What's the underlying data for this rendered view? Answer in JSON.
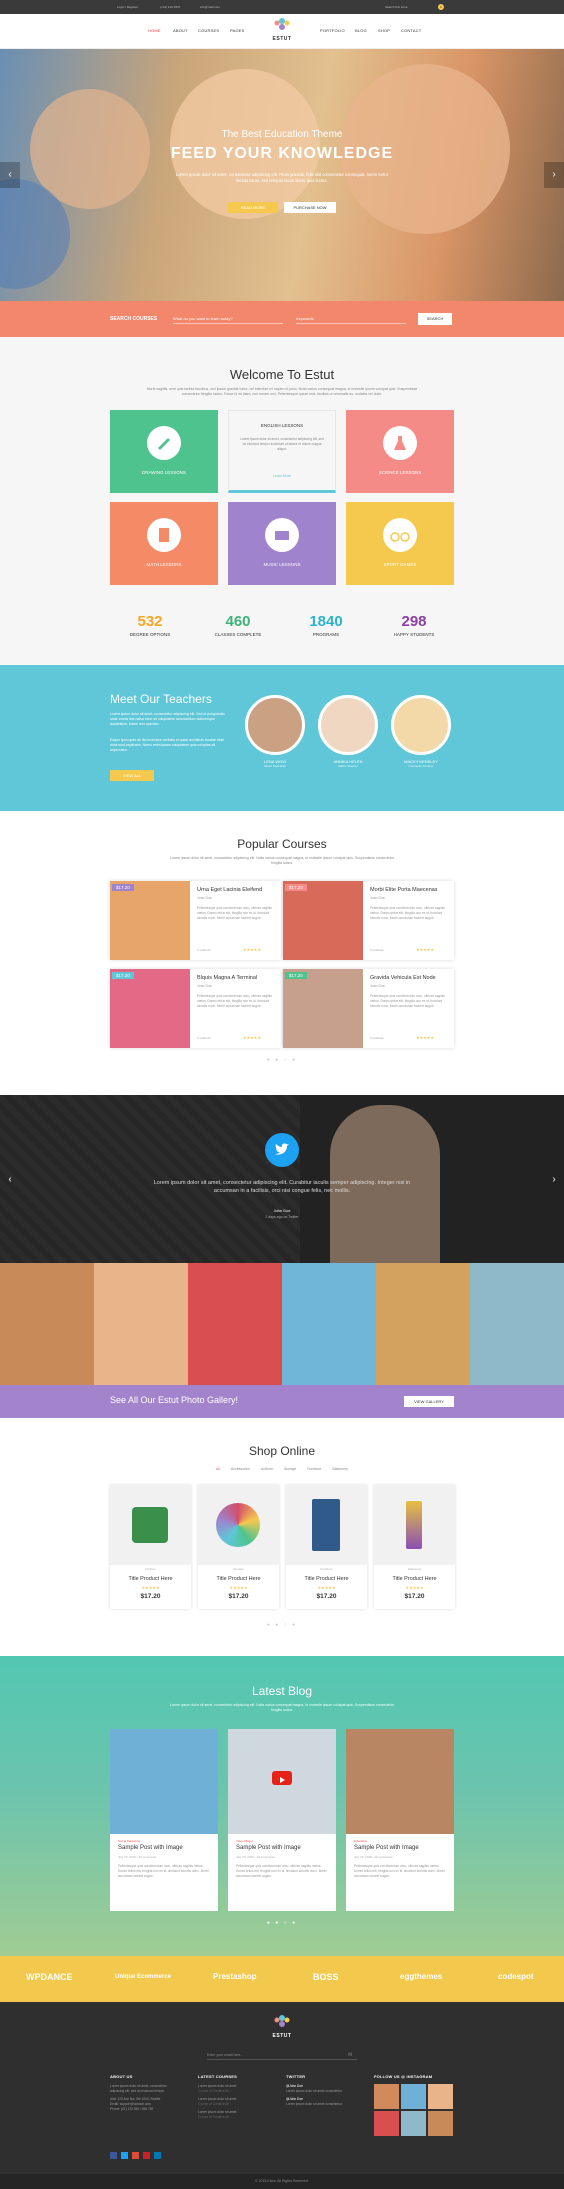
{
  "topbar": {
    "login": "Login / Register",
    "phone": "(+01) 123 4567",
    "email": "info@mail.com",
    "search_placeholder": "Search this store",
    "cart_count": "0"
  },
  "header": {
    "logo_text": "ESTUT",
    "nav_left": [
      "HOME",
      "ABOUT",
      "COURSES",
      "PAGES"
    ],
    "nav_right": [
      "PORTFOLIO",
      "BLOG",
      "SHOP",
      "CONTACT"
    ]
  },
  "hero": {
    "subtitle": "The Best Education Theme",
    "title": "FEED YOUR KNOWLEDGE",
    "text": "Lorem Ipsum dolor sit amet, consectetur adipiscing elit. Proin gravida, felis nisl consectetur consequat, lorem tortor lacinia lacus, sed tempus lacus libero quis lectus.",
    "btn_primary": "READ MORE",
    "btn_secondary": "PURCHASE NOW"
  },
  "search": {
    "label": "SEARCH COURSES",
    "placeholder": "What do you want to learn today?",
    "keyword_placeholder": "Keywords",
    "button": "SEARCH"
  },
  "welcome": {
    "title": "Welcome To Estut",
    "intro": "Morbi sagittis, sem quis lacinia faucibus, orci ipsum gravida tortor, vel interdum mi sapien ut justo. Nulla varius consequat magna, id molestie ipsum volutpat quis. Suspendisse consectetur fringilla luctus. Fusce id mi diam, non ornare orci. Pellentesque ipsum erat, facilisis ut venenatis eu, sodales vel dolor.",
    "cards": [
      {
        "label": "DRAWING LESSONS",
        "color": "#4fc38e",
        "icon": "pencil-icon"
      },
      {
        "label": "ENGLISH LESSONS",
        "color": "#ffffff",
        "icon": "book-icon",
        "text": "Lorem ipsum dolor sit amet, consectetur adipiscing elit, sed do eiusmod tempor incididunt ut labore et dolore magna aliqua.",
        "link": "Learn More"
      },
      {
        "label": "SCIENCE LESSONS",
        "color": "#f58b87",
        "icon": "flask-icon"
      },
      {
        "label": "MATH LESSONS",
        "color": "#f58a67",
        "icon": "calculator-icon"
      },
      {
        "label": "MUSIC LESSONS",
        "color": "#9f83cc",
        "icon": "piano-icon"
      },
      {
        "label": "SPORT GAMES",
        "color": "#f5c94e",
        "icon": "bicycle-icon"
      }
    ],
    "stats": [
      {
        "num": "532",
        "label": "DEGREE OPTIONS",
        "color": "#f5a623"
      },
      {
        "num": "460",
        "label": "CLASSES COMPLETE",
        "color": "#3db37a"
      },
      {
        "num": "1840",
        "label": "PROGRAMS",
        "color": "#2db3c9"
      },
      {
        "num": "298",
        "label": "HAPPY STUDENTS",
        "color": "#8e3fa6"
      }
    ]
  },
  "teachers": {
    "title": "Meet Our Teachers",
    "text1": "Lorem ipsum dolor sit amet, consectetur adipiscing elit. Sed ut perspiciatis unde omnis iste natus error sit voluptatem accusantium doloremque laudantium, totam rem aperiam.",
    "text2": "Eaque ipsa quae ab illo inventore veritatis et quasi architecto beatae vitae dicta sunt explicabo. Nemo enim ipsam voluptatem quia voluptas sit aspernatur.",
    "button": "VIEW ALL",
    "list": [
      {
        "name": "LENA WOW",
        "role": "Music Specialist"
      },
      {
        "name": "ANNIKA HELEN",
        "role": "Maths Teacher"
      },
      {
        "name": "MACEY KENSLEY",
        "role": "Counselor Teacher"
      }
    ]
  },
  "popular": {
    "title": "Popular Courses",
    "intro": "Lorem ipsum dolor sit amet, consectetur adipiscing elit. Nulla varius consequat magna, id molestie ipsum volutpat quis. Suspendisse consectetur fringilla luctus.",
    "courses": [
      {
        "price": "$17.20",
        "price_color": "#9f83cc",
        "title": "Urna Eget Lacinia Eleifend",
        "author": "John Doe",
        "text": "Pellentesque quis condimentum arcu, ultrices sagittis metus. Donec tellus elit, fringilla non ex id, tincidunt lobortis nunc. Morbi accumsan laoreet augue.",
        "students": "5 students",
        "img": "#e8a56a"
      },
      {
        "price": "$17.20",
        "price_color": "#f58b87",
        "title": "Morbi Elite Porta Maecenas",
        "author": "John Doe",
        "text": "Pellentesque quis condimentum arcu, ultrices sagittis metus. Donec tellus elit, fringilla non ex id, tincidunt lobortis nunc. Morbi accumsan laoreet augue.",
        "students": "5 students",
        "img": "#d86a5a"
      },
      {
        "price": "$17.20",
        "price_color": "#5fc7d8",
        "title": "Blquis Magna A Terminal",
        "author": "John Doe",
        "text": "Pellentesque quis condimentum arcu, ultrices sagittis metus. Donec tellus elit, fringilla non ex id, tincidunt lobortis nunc. Morbi accumsan laoreet augue.",
        "students": "5 students",
        "img": "#e26a86"
      },
      {
        "price": "$17.20",
        "price_color": "#4fc38e",
        "title": "Gravida Vehicula Est Node",
        "author": "John Doe",
        "text": "Pellentesque quis condimentum arcu, ultrices sagittis metus. Donec tellus elit, fringilla non ex id, tincidunt lobortis nunc. Morbi accumsan laoreet augue.",
        "students": "5 students",
        "img": "#c6a08c"
      }
    ],
    "rating": "★★★★★"
  },
  "testimonial": {
    "text": "Lorem ipsum dolor sit amet, consectetur adipiscing elit. Curabitur iaculis semper adipiscing. Integer nisi in accumsan in a facilisis, orci nisi congue felis, nec mollis.",
    "author": "John Doe",
    "meta": "2 days ago on Twitter"
  },
  "gallery": {
    "text": "See All Our Estut Photo Gallery!",
    "button": "VIEW GALLERY",
    "tiles": [
      "#c98a5a",
      "#e9b48a",
      "#d94f4f",
      "#6fb6d9",
      "#d2a25e",
      "#8fb9c9"
    ]
  },
  "shop": {
    "title": "Shop Online",
    "filters": [
      "All",
      "Accessories",
      "Uniform",
      "Storage",
      "Furniture",
      "Stationery"
    ],
    "products": [
      {
        "cat": "Uniform",
        "title": "Title Product Here",
        "price": "$17.20",
        "color": "#3a8f4a"
      },
      {
        "cat": "Storage",
        "title": "Title Product Here",
        "price": "$17.20",
        "color": "#d44d6a"
      },
      {
        "cat": "Furniture",
        "title": "Title Product Here",
        "price": "$17.20",
        "color": "#2f5a8a"
      },
      {
        "cat": "Stationery",
        "title": "Title Product Here",
        "price": "$17.20",
        "color": "#e6c040"
      }
    ],
    "rating": "★★★★★"
  },
  "blog": {
    "title": "Latest Blog",
    "intro": "Lorem ipsum dolor sit amet, consectetur adipiscing elit. Nulla varius consequat magna, id molestie ipsum volutpat quis. Suspendisse consectetur fringilla luctus.",
    "posts": [
      {
        "cat": "Social Marketing",
        "title": "Sample Post with Image",
        "meta": "July 15, 2015  •  10 comments",
        "text": "Pellentesque quis condimentum arcu, ultrices sagittis metus. Donec tellus elit, fringilla non ex id, tincidunt lobortis nunc. Morbi accumsan laoreet augue.",
        "img": "#6fb0d6"
      },
      {
        "cat": "Video Player",
        "title": "Sample Post with Image",
        "meta": "July 15, 2015  •  10 comments",
        "text": "Pellentesque quis condimentum arcu, ultrices sagittis metus. Donec tellus elit, fringilla non ex id, tincidunt lobortis nunc. Morbi accumsan laoreet augue.",
        "img": "#cfd8df"
      },
      {
        "cat": "Education",
        "title": "Sample Post with Image",
        "meta": "July 15, 2015  •  10 comments",
        "text": "Pellentesque quis condimentum arcu, ultrices sagittis metus. Donec tellus elit, fringilla non ex id, tincidunt lobortis nunc. Morbi accumsan laoreet augue.",
        "img": "#b98663"
      }
    ]
  },
  "partners": [
    "WPDANCE",
    "Unique Ecommerce",
    "Prestashop",
    "BOSS",
    "eggthemes",
    "codespot"
  ],
  "footer": {
    "logo_text": "ESTUT",
    "newsletter_placeholder": "Enter your email here...",
    "cols": [
      {
        "title": "ABOUT US",
        "lines": [
          "Lorem ipsum dolor sit amet, consectetur",
          "adipiscing elit, sed do eiusmod tempor.",
          "Add: 123 Ave Nw, Ste 1000, Seattle",
          "Email: support@domain.com",
          "Phone: (01) 123 456 / 456 789"
        ]
      },
      {
        "title": "LATEST COURSES",
        "lines": [
          "Lorem ipsum dolor sit amet",
          "Course of Creative Art",
          "Lorem ipsum dolor sit amet",
          "Course of Creative Art",
          "Lorem ipsum dolor sit amet",
          "Course of Creative Art"
        ]
      },
      {
        "title": "TWITTER",
        "lines": [
          "@John Doe",
          "Lorem ipsum dolor sit amet consectetur.",
          "@John Doe",
          "Lorem ipsum dolor sit amet consectetur."
        ]
      },
      {
        "title": "FOLLOW US @ INSTAGRAM",
        "lines": []
      }
    ],
    "copyright": "© 2015 Estut. All Rights Reserved."
  }
}
